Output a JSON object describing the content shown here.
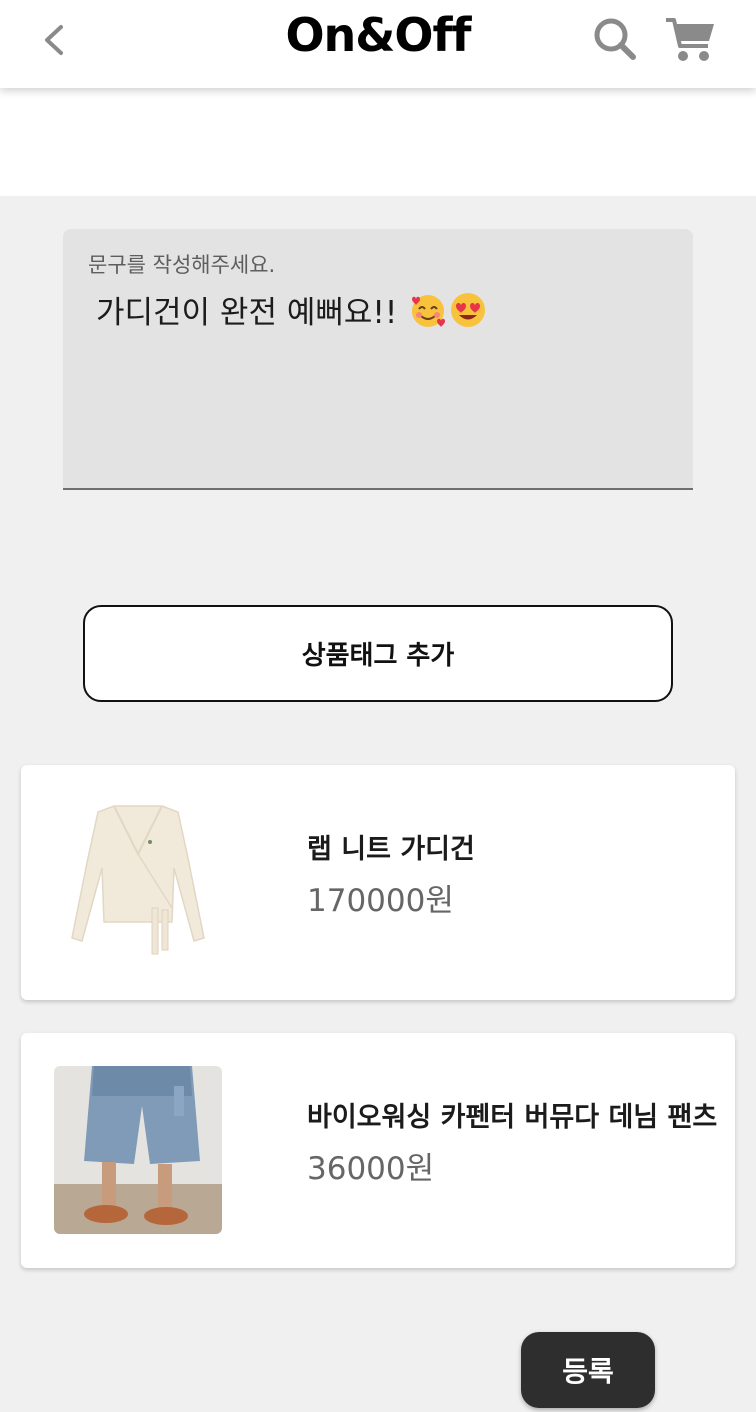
{
  "header": {
    "title": "On&Off",
    "back_icon": "chevron-left-icon",
    "search_icon": "search-icon",
    "cart_icon": "cart-icon"
  },
  "caption": {
    "label": "문구를 작성해주세요.",
    "value": "가디건이 완전 예뻐요!!",
    "emojis": [
      "smiling-face-with-hearts-emoji",
      "heart-eyes-emoji"
    ]
  },
  "tag_button": {
    "label": "상품태그 추가"
  },
  "products": [
    {
      "name": "랩 니트 가디건",
      "price": "170000원",
      "image": "cream-knit-wrap-cardigan"
    },
    {
      "name": "바이오워싱 카펜터 버뮤다 데님 팬츠",
      "price": "36000원",
      "image": "denim-bermuda-shorts"
    }
  ],
  "submit": {
    "label": "등록"
  },
  "colors": {
    "background": "#f0f0f0",
    "field_bg": "#e3e3e3",
    "submit_bg": "#2e2e2e",
    "price_text": "#666666"
  }
}
